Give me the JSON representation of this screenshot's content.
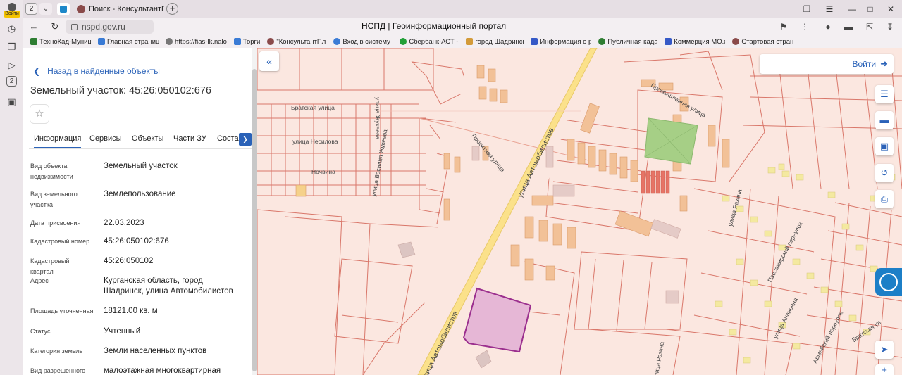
{
  "browser": {
    "profile_label": "Войти",
    "tab_count": "2",
    "active_tab_title": "Поиск - КонсультантПлюс",
    "url": "nspd.gov.ru",
    "page_title": "НСПД | Геоинформационный портал",
    "bookmarks": [
      {
        "label": "ТехноКад-Муници",
        "color": "#2e7d32"
      },
      {
        "label": "Главная страниц",
        "color": "#3a7bd5"
      },
      {
        "label": "https://fias-lk.nalo",
        "color": "#777777"
      },
      {
        "label": "Торги",
        "color": "#3a7bd5"
      },
      {
        "label": "\"КонсультантПлю",
        "color": "#8a4a4a"
      },
      {
        "label": "Вход в систему :",
        "color": "#3a7bd5"
      },
      {
        "label": "Сбербанк-АСТ - :",
        "color": "#21a038"
      },
      {
        "label": "город Шадринск",
        "color": "#d39b3a"
      },
      {
        "label": "Информация о р",
        "color": "#3559c7"
      },
      {
        "label": "Публичная кадас",
        "color": "#2e7d32"
      },
      {
        "label": "Коммерция МО.х",
        "color": "#3559c7"
      },
      {
        "label": "Стартовая стран",
        "color": "#8a4a4a"
      }
    ]
  },
  "panel": {
    "back_label": "Назад в найденные объекты",
    "title": "Земельный участок: 45:26:050102:676",
    "tabs": [
      "Информация",
      "Сервисы",
      "Объекты",
      "Части ЗУ",
      "Соста"
    ],
    "properties": [
      {
        "label": "Вид объекта недвижимости",
        "value": "Земельный участок"
      },
      {
        "label": "Вид земельного участка",
        "value": "Землепользование"
      },
      {
        "label": "Дата присвоения",
        "value": "22.03.2023"
      },
      {
        "label": "Кадастровый номер",
        "value": "45:26:050102:676"
      },
      {
        "label": "Кадастровый квартал",
        "value": "45:26:050102"
      },
      {
        "label": "Адрес",
        "value": "Курганская область, город Шадринск, улица Автомобилистов"
      },
      {
        "label": "Площадь уточненная",
        "value": "18121.00 кв. м"
      },
      {
        "label": "Статус",
        "value": "Учтенный"
      },
      {
        "label": "Категория земель",
        "value": "Земли населенных пунктов"
      },
      {
        "label": "Вид разрешенного",
        "value": "малоэтажная многоквартирная"
      }
    ]
  },
  "map": {
    "login_label": "Войти",
    "streets": {
      "bratskaya": "Братская улица",
      "nesilova": "улица Несилова",
      "nochvina": "Ночвина",
      "vasily_zhukeeva": "улица Василия Жукеева",
      "zhukeeva": "улица Жукеева",
      "proektnaya": "Проектная улица",
      "avtomobilistov": "улица Автомобилистов",
      "avtomobilistov_lower": "улица Автомобилистов",
      "promyshlennaya": "Промышленная улица",
      "razina": "улица Разина",
      "razina_lower": "улица Разина",
      "passazhirsky": "Пассажирский переулок",
      "ananyina": "улица Ананьина",
      "armeisky": "Армейский переулок",
      "bratskaya_right": "Братская ул"
    }
  }
}
